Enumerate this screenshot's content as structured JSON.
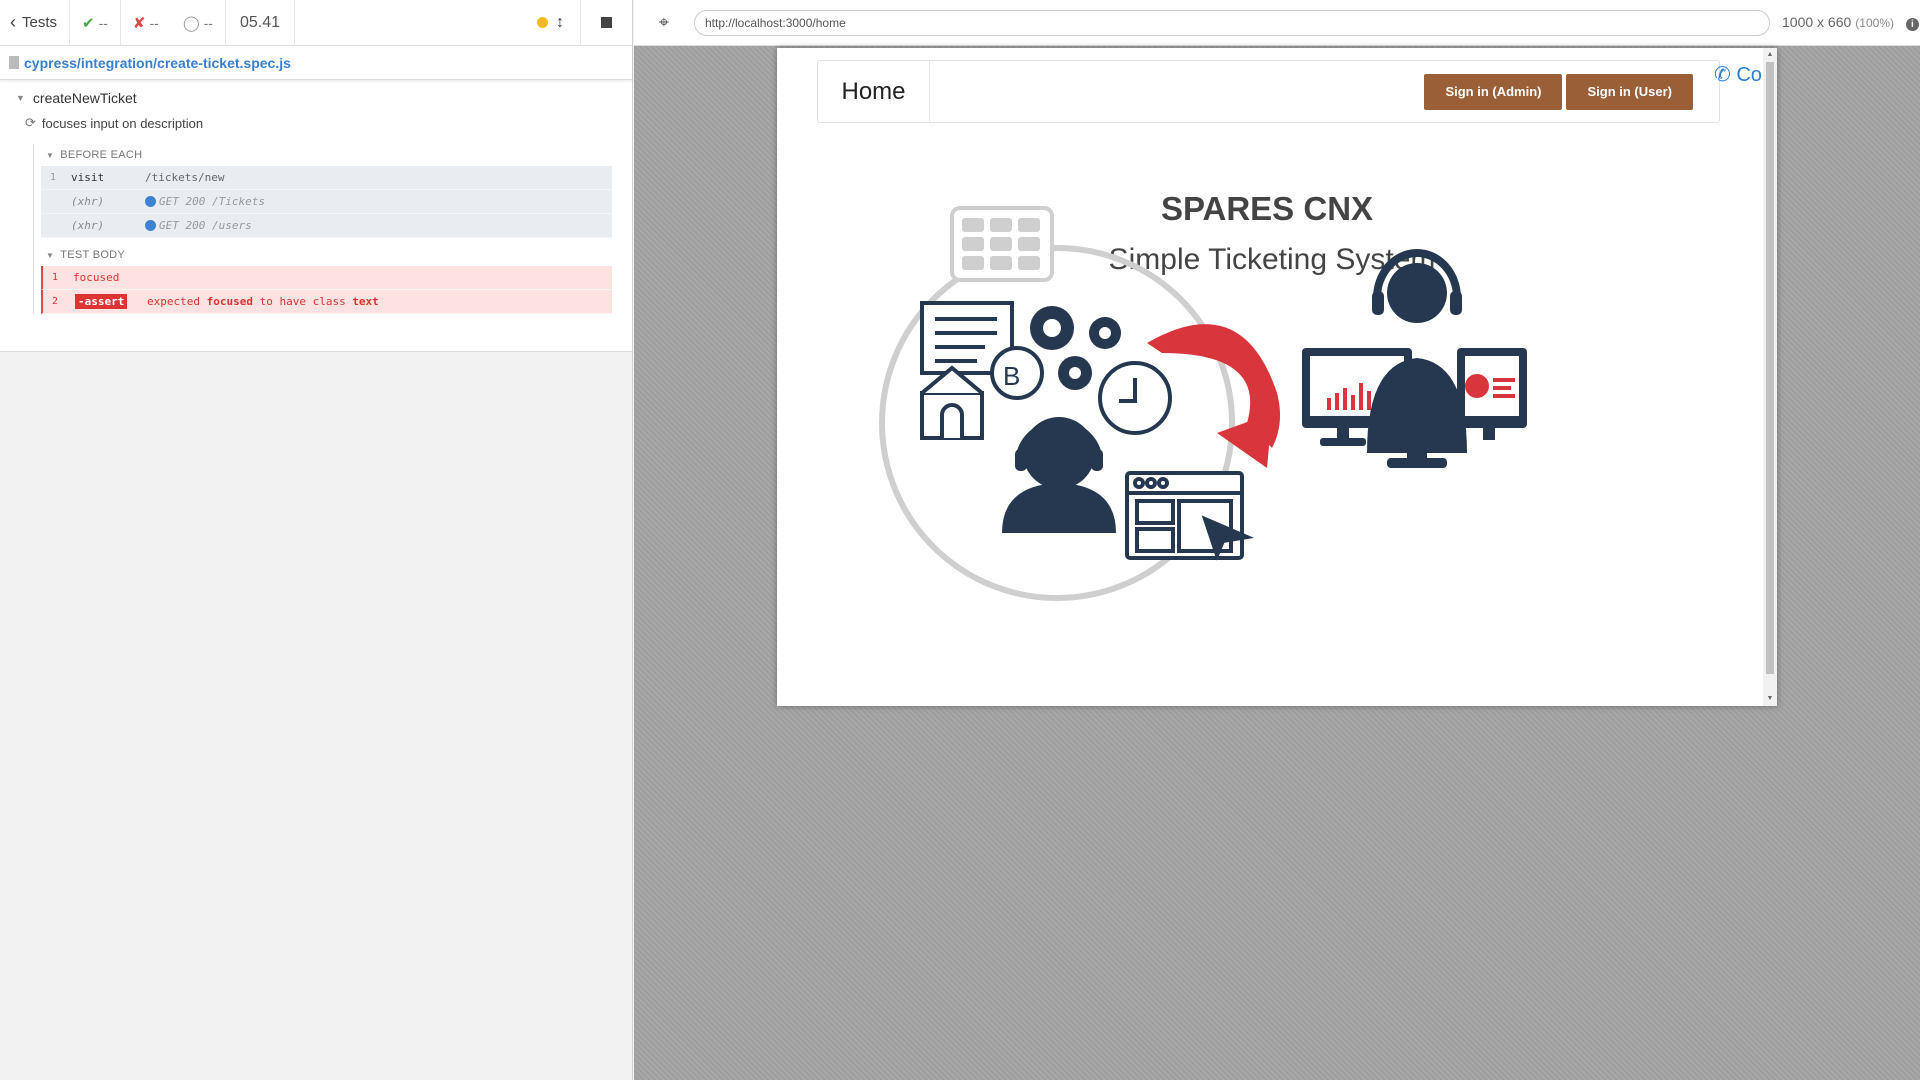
{
  "reporter": {
    "tests_label": "Tests",
    "passed_count": "--",
    "failed_count": "--",
    "pending_count": "--",
    "duration": "05.41",
    "spec_path": "cypress/integration/create-ticket.spec.js",
    "suite_title": "createNewTicket",
    "test_title": "focuses input on description",
    "hooks": [
      {
        "title": "BEFORE EACH",
        "commands": [
          {
            "num": "1",
            "name": "visit",
            "message": "/tickets/new"
          },
          {
            "num": "",
            "name": "(xhr)",
            "message": "GET 200 /Tickets"
          },
          {
            "num": "",
            "name": "(xhr)",
            "message": "GET 200 /users"
          }
        ]
      },
      {
        "title": "TEST BODY",
        "commands": [
          {
            "num": "1",
            "name": "focused",
            "message": ""
          },
          {
            "num": "2",
            "name": "-assert",
            "message_parts": [
              "expected",
              "focused",
              "to have class",
              "text"
            ]
          }
        ]
      }
    ]
  },
  "aut": {
    "url": "http://localhost:3000/home",
    "viewport_size": "1000 x 660",
    "viewport_scale": "(100%)",
    "app": {
      "brand": "Home",
      "sign_in_admin": "Sign in (Admin)",
      "sign_in_user": "Sign in (User)",
      "contact_partial": "Co",
      "title": "SPARES CNX",
      "subtitle": "Simple Ticketing System"
    }
  },
  "colors": {
    "pass": "#4ea34e",
    "fail": "#e04848",
    "running": "#f4b927",
    "link": "#3980d0",
    "sign_in_button": "#9a5f37",
    "illustration_navy": "#263850",
    "illustration_red": "#d8363c"
  }
}
